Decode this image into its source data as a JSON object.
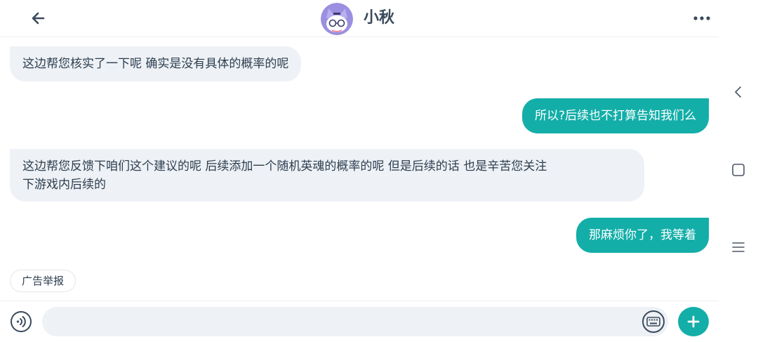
{
  "header": {
    "title": "小秋"
  },
  "messages": [
    {
      "side": "in",
      "text": "这边帮您核实了一下呢 确实是没有具体的概率的呢"
    },
    {
      "side": "out",
      "text": "所以?后续也不打算告知我们么"
    },
    {
      "side": "in",
      "text": "这边帮您反馈下咱们这个建议的呢 后续添加一个随机英魂的概率的呢 但是后续的话 也是辛苦您关注\n下游戏内后续的"
    },
    {
      "side": "out",
      "text": "那麻烦你了，我等着"
    }
  ],
  "report_label": "广告举报",
  "input": {
    "value": "",
    "placeholder": ""
  },
  "colors": {
    "accent": "#13aea8",
    "incoming_bubble": "#eef1f5",
    "text": "#2c3e50"
  },
  "icons": {
    "back": "arrow-left-icon",
    "more": "more-dots-icon",
    "voice": "voice-icon",
    "keyboard": "keyboard-icon",
    "add": "plus-icon",
    "nav_back": "chevron-left-icon",
    "nav_home": "square-icon",
    "nav_menu": "menu-icon"
  }
}
